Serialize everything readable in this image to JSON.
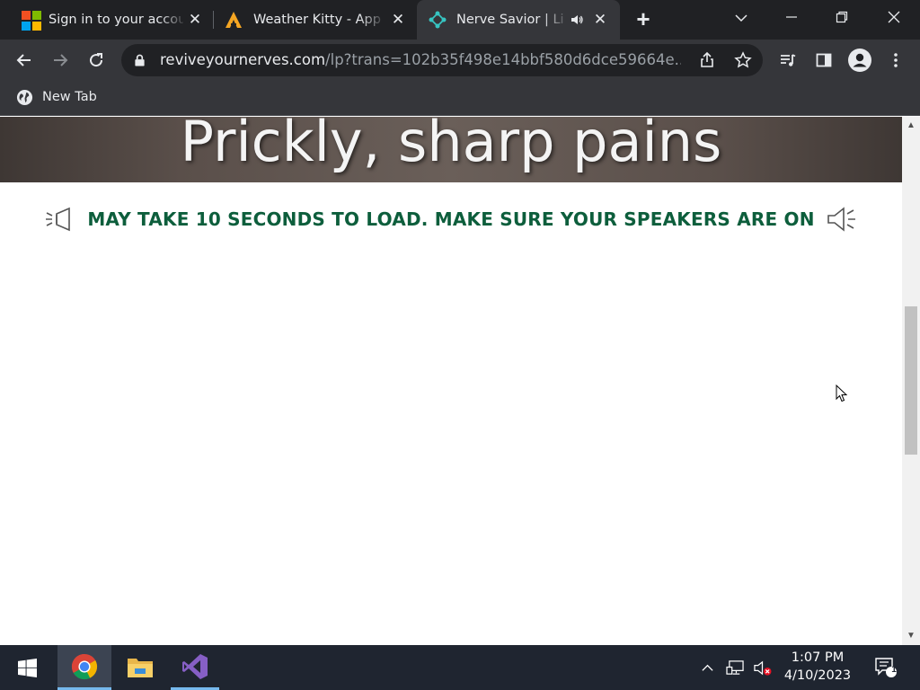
{
  "browser": {
    "tabs": [
      {
        "title": "Sign in to your account",
        "active": false,
        "icon": "microsoft-logo-icon"
      },
      {
        "title": "Weather Kitty - App",
        "active": false,
        "icon": "weather-kitty-logo-icon"
      },
      {
        "title": "Nerve Savior | Li",
        "active": true,
        "icon": "nerve-savior-logo-icon",
        "audio": "speaker-icon"
      }
    ],
    "new_tab_symbol": "+",
    "close_symbol": "✕",
    "address": {
      "host": "reviveyournerves.com",
      "path": "/lp?trans=102b35f498e14bbf580d6dce59664e..."
    },
    "bookmarks": [
      {
        "label": "New Tab",
        "icon": "globe-icon"
      }
    ]
  },
  "page": {
    "hero_title": "Prickly, sharp pains",
    "notice": "MAY TAKE 10 SECONDS TO LOAD. MAKE SURE YOUR SPEAKERS ARE ON"
  },
  "taskbar": {
    "time": "1:07 PM",
    "date": "4/10/2023",
    "notification_count": "1"
  },
  "colors": {
    "notice_green": "#0d5e3c",
    "browser_dark": "#202124",
    "toolbar": "#35363a",
    "taskbar": "#1f2530"
  }
}
